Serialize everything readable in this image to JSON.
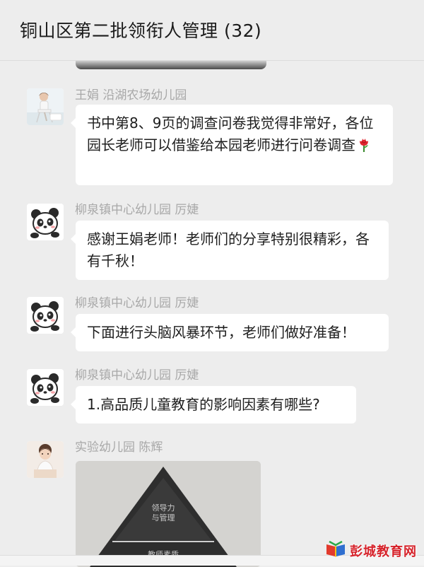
{
  "header": {
    "title": "铜山区第二批领衔人管理 (32)"
  },
  "messages": [
    {
      "sender": "王娟 沿湖农场幼儿园",
      "text": "书中第8、9页的调查问卷我觉得非常好，各位园长老师可以借鉴给本园老师进行问卷调查",
      "emoji": "rose-emoji"
    },
    {
      "sender": "柳泉镇中心幼儿园 厉婕",
      "text": "感谢王娟老师！老师们的分享特别很精彩，各有千秋！"
    },
    {
      "sender": "柳泉镇中心幼儿园 厉婕",
      "text": "下面进行头脑风暴环节，老师们做好准备！"
    },
    {
      "sender": "柳泉镇中心幼儿园 厉婕",
      "text": "1.高品质儿童教育的影响因素有哪些?"
    },
    {
      "sender": "实验幼儿园 陈辉",
      "image_text_top": "领导力\n与管理",
      "image_text_bottom": "教师素质"
    }
  ],
  "watermark": {
    "text": "彭城教育网",
    "logo_icon": "book-logo-icon"
  },
  "colors": {
    "background": "#ededed",
    "bubble": "#ffffff",
    "sender_name": "#a8a8a8",
    "watermark": "#d6232b"
  }
}
